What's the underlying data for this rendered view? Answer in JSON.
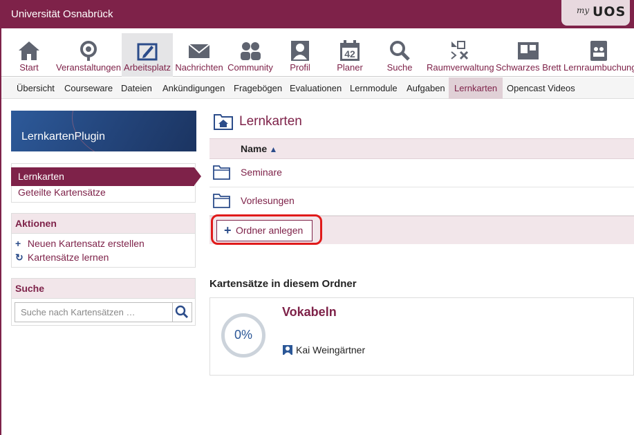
{
  "header": {
    "brand": "Universität Osnabrück",
    "my_logo": "my",
    "uos_logo": "UOS"
  },
  "navbar": {
    "items": [
      {
        "label": "Start",
        "icon": "home-icon"
      },
      {
        "label": "Veranstaltungen",
        "icon": "seminar-icon"
      },
      {
        "label": "Arbeitsplatz",
        "icon": "workplace-icon",
        "active": true
      },
      {
        "label": "Nachrichten",
        "icon": "mail-icon"
      },
      {
        "label": "Community",
        "icon": "community-icon"
      },
      {
        "label": "Profil",
        "icon": "profile-icon"
      },
      {
        "label": "Planer",
        "icon": "calendar-icon",
        "day": "42"
      },
      {
        "label": "Suche",
        "icon": "search-icon"
      },
      {
        "label": "Raumverwaltung",
        "icon": "room-icon"
      },
      {
        "label": "Schwarzes Brett",
        "icon": "board-icon"
      },
      {
        "label": "Lernraumbuchung",
        "icon": "booking-icon"
      }
    ]
  },
  "subnav": {
    "tabs": [
      {
        "label": "Übersicht"
      },
      {
        "label": "Courseware"
      },
      {
        "label": "Dateien"
      },
      {
        "label": "Ankündigungen"
      },
      {
        "label": "Fragebögen"
      },
      {
        "label": "Evaluationen"
      },
      {
        "label": "Lernmodule"
      },
      {
        "label": "Aufgaben"
      },
      {
        "label": "Lernkarten",
        "active": true
      },
      {
        "label": "Opencast Videos"
      }
    ]
  },
  "sidebar": {
    "plugin_title": "LernkartenPlugin",
    "nav_active": "Lernkarten",
    "nav_item": "Geteilte Kartensätze",
    "actions_title": "Aktionen",
    "action_create": "Neuen Kartensatz erstellen",
    "action_learn": "Kartensätze lernen",
    "search_title": "Suche",
    "search_placeholder": "Suche nach Kartensätzen …"
  },
  "main": {
    "title": "Lernkarten",
    "column_name": "Name",
    "folders": [
      {
        "name": "Seminare"
      },
      {
        "name": "Vorlesungen"
      }
    ],
    "new_folder_button": "Ordner anlegen",
    "section_title": "Kartensätze in diesem Ordner",
    "card": {
      "title": "Vokabeln",
      "progress": "0%",
      "progress_value": 0,
      "author": "Kai Weingärtner"
    }
  },
  "colors": {
    "brand": "#7e2249",
    "accent_blue": "#2b4c8a",
    "highlight": "#e01a1a"
  }
}
